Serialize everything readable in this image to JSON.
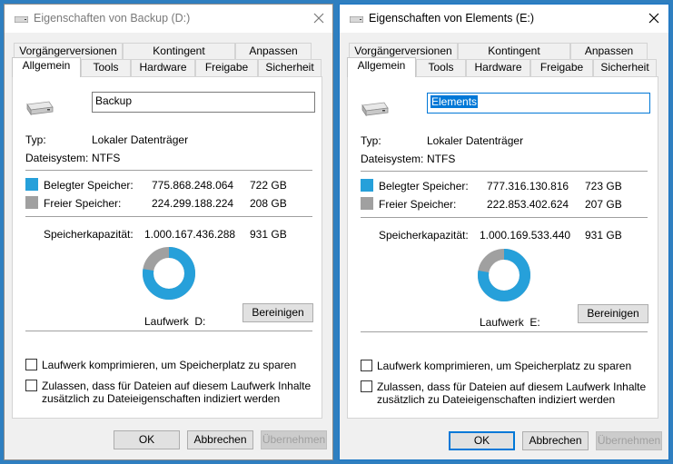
{
  "colors": {
    "used": "#26a0da",
    "free": "#a0a0a0",
    "desktop": "#2f7fc0"
  },
  "tabs_top": [
    "Vorgängerversionen",
    "Kontingent",
    "Anpassen"
  ],
  "tabs_bottom": [
    "Allgemein",
    "Tools",
    "Hardware",
    "Freigabe",
    "Sicherheit"
  ],
  "dialogs": [
    {
      "title": "Eigenschaften von Backup (D:)",
      "name": "Backup",
      "type_label": "Typ:",
      "type_value": "Lokaler Datenträger",
      "fs_label": "Dateisystem:",
      "fs_value": "NTFS",
      "used_label": "Belegter Speicher:",
      "used_bytes": "775.868.248.064",
      "used_gb": "722 GB",
      "free_label": "Freier Speicher:",
      "free_bytes": "224.299.188.224",
      "free_gb": "208 GB",
      "cap_label": "Speicherkapazität:",
      "cap_bytes": "1.000.167.436.288",
      "cap_gb": "931 GB",
      "used_fraction": 0.7758,
      "drive_label": "Laufwerk  D:",
      "cleanup": "Bereinigen",
      "compress": "Laufwerk komprimieren, um Speicherplatz zu sparen",
      "index_line1": "Zulassen, dass für Dateien auf diesem Laufwerk Inhalte",
      "index_line2": "zusätzlich zu Dateieigenschaften indiziert werden",
      "ok": "OK",
      "cancel": "Abbrechen",
      "apply": "Übernehmen"
    },
    {
      "title": "Eigenschaften von Elements (E:)",
      "name": "Elements",
      "type_label": "Typ:",
      "type_value": "Lokaler Datenträger",
      "fs_label": "Dateisystem:",
      "fs_value": "NTFS",
      "used_label": "Belegter Speicher:",
      "used_bytes": "777.316.130.816",
      "used_gb": "723 GB",
      "free_label": "Freier Speicher:",
      "free_bytes": "222.853.402.624",
      "free_gb": "207 GB",
      "cap_label": "Speicherkapazität:",
      "cap_bytes": "1.000.169.533.440",
      "cap_gb": "931 GB",
      "used_fraction": 0.7772,
      "drive_label": "Laufwerk  E:",
      "cleanup": "Bereinigen",
      "compress": "Laufwerk komprimieren, um Speicherplatz zu sparen",
      "index_line1": "Zulassen, dass für Dateien auf diesem Laufwerk Inhalte",
      "index_line2": "zusätzlich zu Dateieigenschaften indiziert werden",
      "ok": "OK",
      "cancel": "Abbrechen",
      "apply": "Übernehmen"
    }
  ]
}
